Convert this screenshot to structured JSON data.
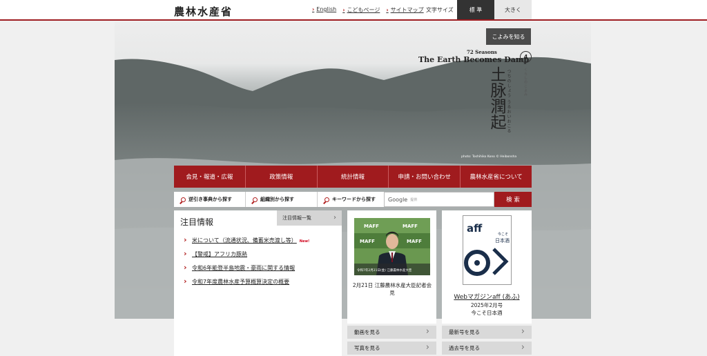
{
  "header": {
    "logo": "農林水産省",
    "links": [
      "English",
      "こどもページ",
      "サイトマップ"
    ],
    "font_size_label": "文字サイズ",
    "font_std": "標 準",
    "font_big": "大きく"
  },
  "hero": {
    "koyomi_button": "こよみを知る",
    "season_label": "72 Seasons",
    "season_title": "The Earth Becomes Damp",
    "season_number": "4",
    "season_kanji": "土脉潤起",
    "season_reading": "つちのしょう うるおいおこる",
    "season_reading2": "くらしのこよみ",
    "photo_credit": "photo: Toshihiko Kono © Heibonsha"
  },
  "nav": {
    "items": [
      "会見・報道・広報",
      "政策情報",
      "統計情報",
      "申請・お問い合わせ",
      "農林水産省について"
    ]
  },
  "search": {
    "index_button": "逆引き事典から探す",
    "org_button": "組織別から探す",
    "keyword_label": "キーワードから探す",
    "google_label": "Google",
    "google_placeholder": "提供",
    "submit": "検 索"
  },
  "attention": {
    "title": "注目情報",
    "more": "注目情報一覧",
    "items": [
      "米について（流通状況、備蓄米売渡し等）",
      "【警戒】アフリカ豚熱",
      "令和6年能登半島地震・豪雨に関する情報",
      "令和7年度農林水産予算概算決定の概要"
    ],
    "new_badge": "New!"
  },
  "press": {
    "caption": "2月21日 江藤農林水産大臣記者会見",
    "video_link": "動画を見る",
    "photo_link": "写真を見る",
    "backdrop_text": "MAFF",
    "subtitle": "令和7年2月21日(金) 江藤農林水産大臣"
  },
  "magazine": {
    "title": "Webマガジンaff (あふ)",
    "issue": "2025年2月号",
    "theme": "今こそ日本酒",
    "latest_link": "最新号を見る",
    "past_link": "過去号を見る",
    "cover_logo": "aff",
    "cover_title": "日本酒",
    "cover_sub": "今こそ"
  }
}
